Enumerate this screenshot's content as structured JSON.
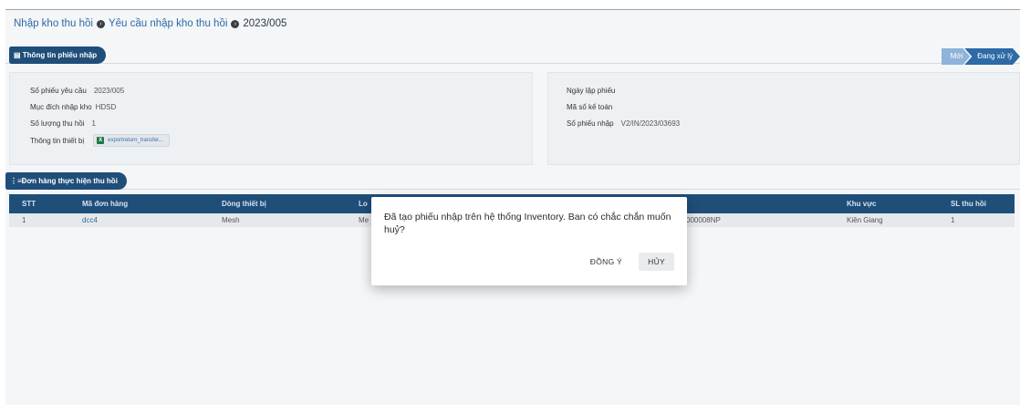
{
  "breadcrumb": {
    "item1": "Nhập kho thu hồi",
    "item2": "Yêu cầu nhập kho thu hồi",
    "item3": "2023/005"
  },
  "section_info": {
    "title": "Thông tin phiếu nhập",
    "status_steps": [
      "Mới",
      "Đang xử lý"
    ],
    "active_step": "Đang xử lý"
  },
  "info_left": {
    "so_phieu_label": "Số phiếu yêu cầu",
    "so_phieu_value": "2023/005",
    "muc_dich_label": "Mục đích nhập kho",
    "muc_dich_value": "HDSD",
    "so_luong_label": "Số lượng thu hồi",
    "so_luong_value": "1",
    "thiet_bi_label": "Thông tin thiết bị",
    "thiet_bi_file": "exportreturn_transfer..."
  },
  "info_right": {
    "ngay_lap_label": "Ngày lập phiếu",
    "ma_ke_toan_label": "Mã số kế toán",
    "so_phieu_nhap_label": "Số phiếu nhập",
    "so_phieu_nhap_value": "V2/IN/2023/03693"
  },
  "section_orders": {
    "title": "Đơn hàng thực hiện thu hồi"
  },
  "table": {
    "headers": [
      "STT",
      "Mã đơn hàng",
      "Dòng thiết bị",
      "Lo",
      "Khu vực",
      "SL thu hồi"
    ],
    "rows": [
      {
        "stt": "1",
        "ma_don": "dcc4",
        "dong_tb": "Mesh",
        "lo": "Me",
        "serial": "000008NP",
        "khu_vuc": "Kiên Giang",
        "sl": "1"
      }
    ]
  },
  "dialog": {
    "message": "Đã tạo phiếu nhập trên hệ thống Inventory. Ban có chắc chắn muốn huỷ?",
    "confirm_label": "ĐỒNG Ý",
    "cancel_label": "HỦY"
  },
  "colors": {
    "header_blue": "#1f4e79",
    "link_blue": "#2d6aa6",
    "step_inactive": "#8fb3d9"
  }
}
